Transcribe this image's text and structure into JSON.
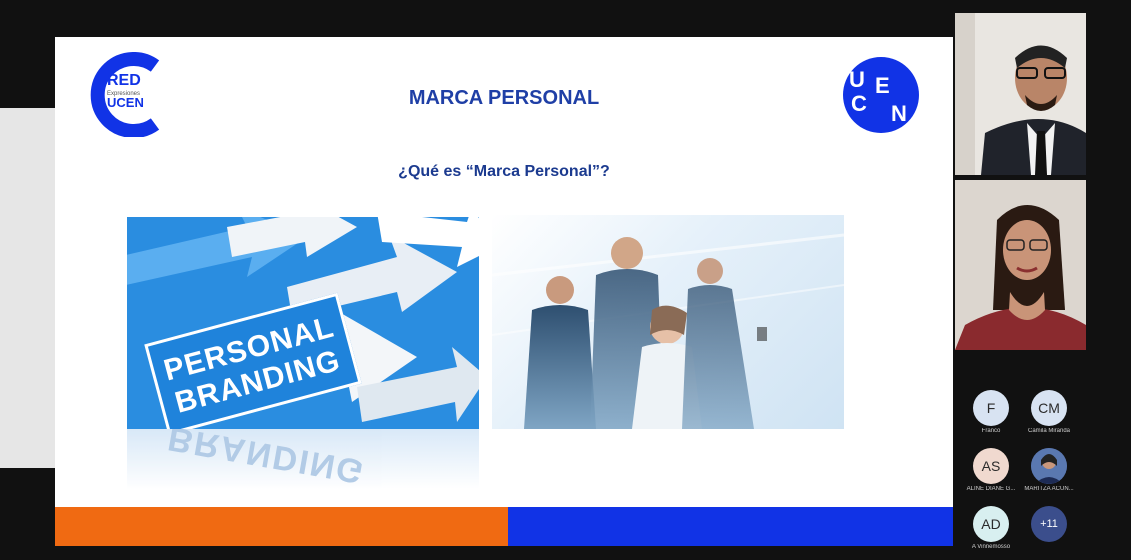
{
  "slide": {
    "title": "MARCA PERSONAL",
    "question": "¿Qué es “Marca Personal”?",
    "logo_left": {
      "line1": "RED",
      "line2": "Expresiones",
      "line3": "UCEN"
    },
    "logo_right": {
      "letters": [
        "U",
        "C",
        "E",
        "N"
      ]
    },
    "branding_text": "PERSONAL BRANDING",
    "branding_reflection": "BRANDING"
  },
  "colors": {
    "title_blue": "#1f3fa6",
    "bar_orange": "#f06a12",
    "bar_blue": "#1133e6",
    "logo_blue": "#1133e6"
  },
  "participants": [
    {
      "initials": "F",
      "name": "Franco",
      "color": "#d8e3f2"
    },
    {
      "initials": "CM",
      "name": "Camila Miranda",
      "color": "#d8e3f2"
    },
    {
      "initials": "AS",
      "name": "ALINE DIANE G...",
      "color": "#f0d9cf"
    },
    {
      "initials": "",
      "name": "MARITZA ACUÑ...",
      "color": "#3a4a7a"
    },
    {
      "initials": "AD",
      "name": "A Vinnemosso",
      "color": "#d8eff0"
    },
    {
      "initials": "+11",
      "name": "",
      "color": "#3b4e8c"
    }
  ]
}
